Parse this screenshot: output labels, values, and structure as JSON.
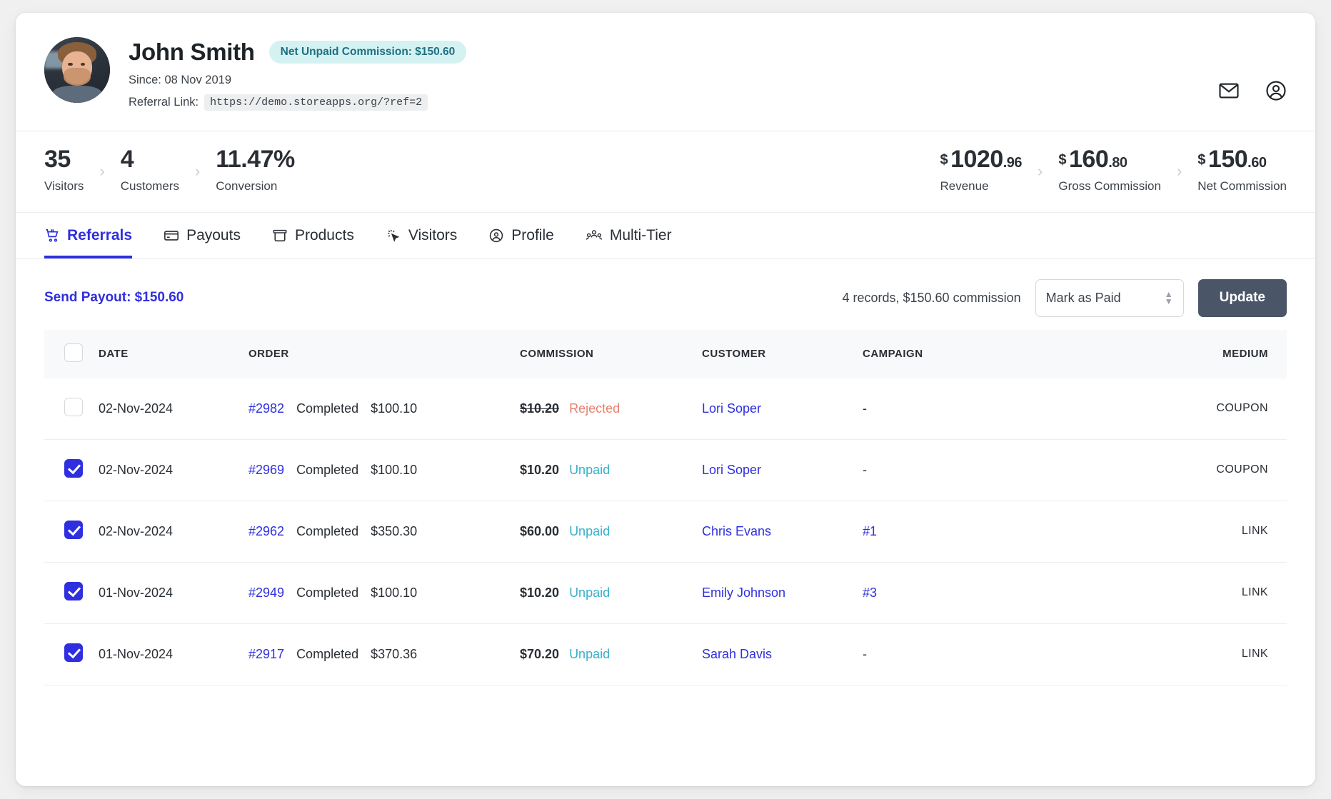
{
  "header": {
    "avatar_alt": "John Smith profile photo",
    "name": "John Smith",
    "badge": "Net Unpaid Commission: $150.60",
    "since": "Since: 08 Nov 2019",
    "referral_label": "Referral Link:",
    "referral_url": "https://demo.storeapps.org/?ref=2",
    "icons": [
      "mail-icon",
      "account-circle-icon"
    ]
  },
  "stats": {
    "left": [
      {
        "value": "35",
        "label": "Visitors"
      },
      {
        "value": "4",
        "label": "Customers"
      },
      {
        "value": "11.47%",
        "label": "Conversion"
      }
    ],
    "right": [
      {
        "currency": "$",
        "whole": "1020",
        "decimal": ".96",
        "label": "Revenue"
      },
      {
        "currency": "$",
        "whole": "160",
        "decimal": ".80",
        "label": "Gross Commission"
      },
      {
        "currency": "$",
        "whole": "150",
        "decimal": ".60",
        "label": "Net Commission"
      }
    ],
    "separator": "›"
  },
  "tabs": [
    {
      "label": "Referrals",
      "icon": "cart-icon",
      "active": true
    },
    {
      "label": "Payouts",
      "icon": "card-icon",
      "active": false
    },
    {
      "label": "Products",
      "icon": "box-icon",
      "active": false
    },
    {
      "label": "Visitors",
      "icon": "cursor-click-icon",
      "active": false
    },
    {
      "label": "Profile",
      "icon": "user-circle-icon",
      "active": false
    },
    {
      "label": "Multi-Tier",
      "icon": "users-group-icon",
      "active": false
    }
  ],
  "toolbar": {
    "send_payout": "Send Payout: $150.60",
    "records": "4 records, $150.60 commission",
    "select_value": "Mark as Paid",
    "update_label": "Update"
  },
  "table": {
    "columns": [
      "DATE",
      "ORDER",
      "COMMISSION",
      "CUSTOMER",
      "CAMPAIGN",
      "MEDIUM"
    ],
    "header_checkbox_checked": false,
    "rows": [
      {
        "checked": false,
        "date": "02-Nov-2024",
        "order_id": "#2982",
        "order_status": "Completed",
        "order_amount": "$100.10",
        "commission": "$10.20",
        "commission_struck": true,
        "status": "Rejected",
        "status_kind": "rejected",
        "customer": "Lori Soper",
        "campaign": "-",
        "campaign_link": false,
        "medium": "COUPON"
      },
      {
        "checked": true,
        "date": "02-Nov-2024",
        "order_id": "#2969",
        "order_status": "Completed",
        "order_amount": "$100.10",
        "commission": "$10.20",
        "commission_struck": false,
        "status": "Unpaid",
        "status_kind": "unpaid",
        "customer": "Lori Soper",
        "campaign": "-",
        "campaign_link": false,
        "medium": "COUPON"
      },
      {
        "checked": true,
        "date": "02-Nov-2024",
        "order_id": "#2962",
        "order_status": "Completed",
        "order_amount": "$350.30",
        "commission": "$60.00",
        "commission_struck": false,
        "status": "Unpaid",
        "status_kind": "unpaid",
        "customer": "Chris Evans",
        "campaign": "#1",
        "campaign_link": true,
        "medium": "LINK"
      },
      {
        "checked": true,
        "date": "01-Nov-2024",
        "order_id": "#2949",
        "order_status": "Completed",
        "order_amount": "$100.10",
        "commission": "$10.20",
        "commission_struck": false,
        "status": "Unpaid",
        "status_kind": "unpaid",
        "customer": "Emily Johnson",
        "campaign": "#3",
        "campaign_link": true,
        "medium": "LINK"
      },
      {
        "checked": true,
        "date": "01-Nov-2024",
        "order_id": "#2917",
        "order_status": "Completed",
        "order_amount": "$370.36",
        "commission": "$70.20",
        "commission_struck": false,
        "status": "Unpaid",
        "status_kind": "unpaid",
        "customer": "Sarah Davis",
        "campaign": "-",
        "campaign_link": false,
        "medium": "LINK"
      }
    ]
  },
  "colors": {
    "accent_blue": "#2f2fe0",
    "badge_bg": "#d5f2f3",
    "badge_text": "#1f6f80",
    "unpaid": "#36b0c9",
    "rejected": "#e8806e",
    "update_btn": "#4a5568"
  }
}
